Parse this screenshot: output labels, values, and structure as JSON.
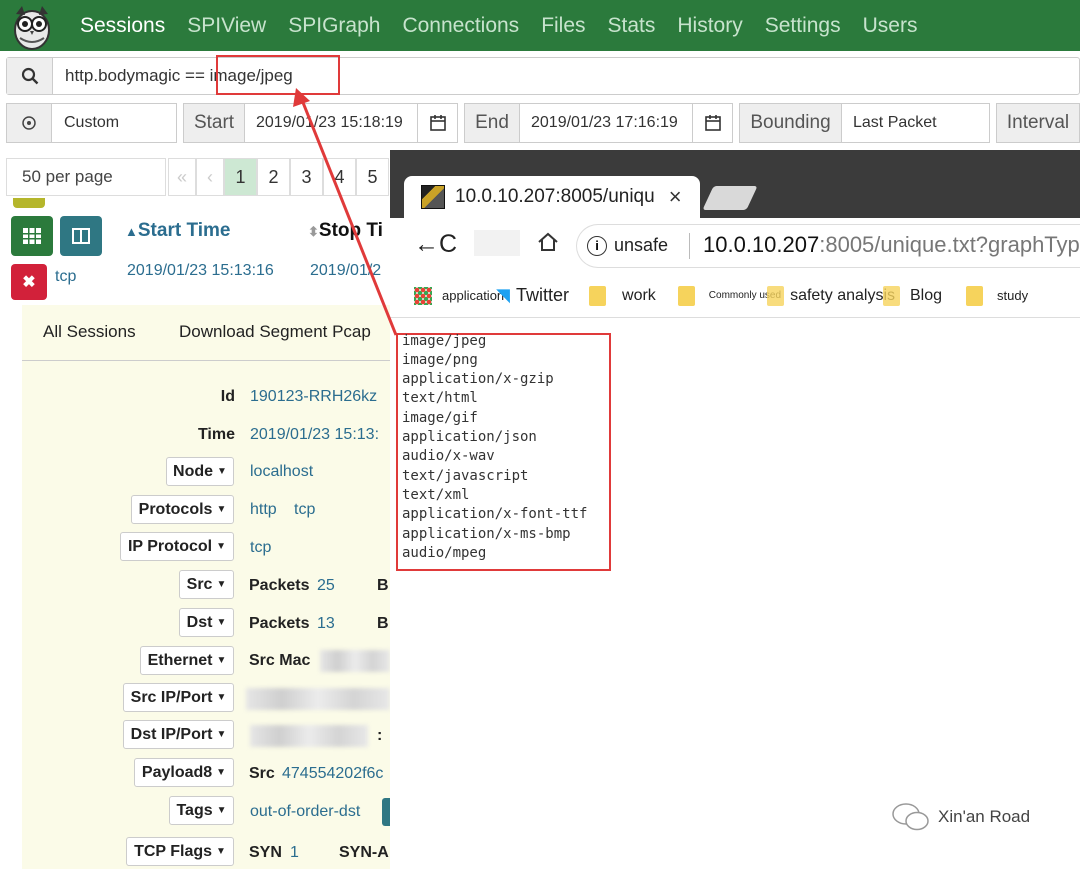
{
  "nav": {
    "items": [
      "Sessions",
      "SPIView",
      "SPIGraph",
      "Connections",
      "Files",
      "Stats",
      "History",
      "Settings",
      "Users"
    ]
  },
  "search": {
    "prefix": "http.bodymagic == ",
    "value": "image/jpeg"
  },
  "time": {
    "range": "Custom",
    "start_label": "Start",
    "start_value": "2019/01/23 15:18:19",
    "end_label": "End",
    "end_value": "2019/01/23 17:16:19",
    "bounding_label": "Bounding",
    "bounding_value": "Last Packet",
    "interval_label": "Interval"
  },
  "pager": {
    "per_page": "50 per page",
    "first": "«",
    "prev": "‹",
    "pages": [
      "1",
      "2",
      "3",
      "4",
      "5"
    ]
  },
  "table": {
    "col_start": "Start Time",
    "col_stop": "Stop Ti",
    "row": {
      "protocol": "tcp",
      "start": "2019/01/23 15:13:16",
      "stop": "2019/01/2"
    }
  },
  "detail": {
    "all_sessions": "All Sessions",
    "download": "Download Segment Pcap",
    "id_label": "Id",
    "id_value": "190123-RRH26kz",
    "time_label": "Time",
    "time_value": "2019/01/23 15:13:",
    "node_label": "Node",
    "node_value": "localhost",
    "protocols_label": "Protocols",
    "protocols_values": [
      "http",
      "tcp"
    ],
    "ipproto_label": "IP Protocol",
    "ipproto_value": "tcp",
    "src_label": "Src",
    "src_packets_label": "Packets",
    "src_packets_value": "25",
    "src_b": "B",
    "dst_label": "Dst",
    "dst_packets_label": "Packets",
    "dst_packets_value": "13",
    "dst_b": "B",
    "ethernet_label": "Ethernet",
    "srcmac_label": "Src Mac",
    "srcipport_label": "Src IP/Port",
    "dstipport_label": "Dst IP/Port",
    "dst_colon": ":",
    "payload_label": "Payload8",
    "payload_src_label": "Src",
    "payload_src_value": "474554202f6c",
    "tags_label": "Tags",
    "tags_value": "out-of-order-dst",
    "tcpflags_label": "TCP Flags",
    "syn_label": "SYN",
    "syn_value": "1",
    "synack_label": "SYN-A"
  },
  "browser": {
    "tab_title": "10.0.10.207:8005/uniqu",
    "tab_close": "×",
    "nav_back": "←C",
    "security": "unsafe",
    "url_host": "10.0.10.207",
    "url_rest": ":8005/unique.txt?graphTyp",
    "bookmarks": [
      "application",
      "Twitter",
      "work",
      "Commonly used",
      "safety analysis",
      "Blog",
      "study"
    ]
  },
  "mime_types": [
    "image/jpeg",
    "image/png",
    "application/x-gzip",
    "text/html",
    "image/gif",
    "application/json",
    "audio/x-wav",
    "text/javascript",
    "text/xml",
    "application/x-font-ttf",
    "application/x-ms-bmp",
    "audio/mpeg"
  ],
  "watermark": "Xin'an Road",
  "colors": {
    "nav_bg": "#2b7a3c",
    "link": "#2b6d8f",
    "highlight": "#e03a3a",
    "danger": "#d2213a"
  }
}
